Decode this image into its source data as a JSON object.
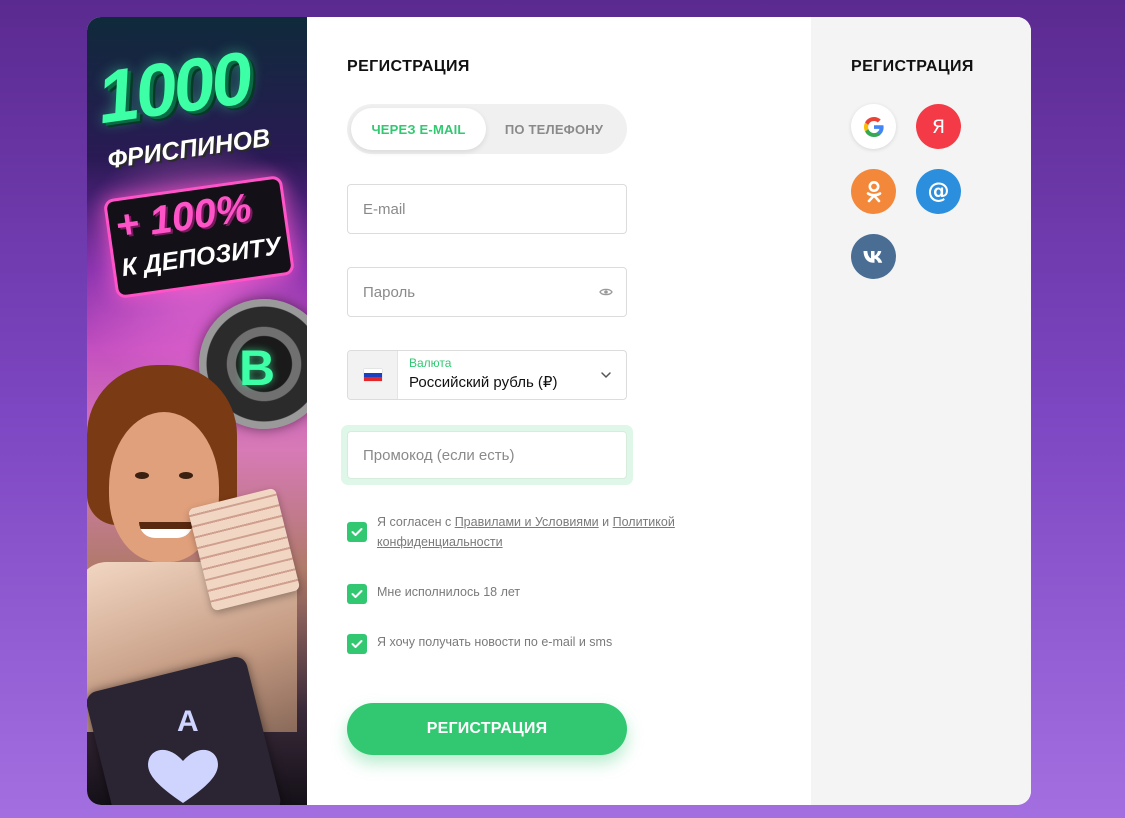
{
  "banner": {
    "headline_number": "1000",
    "headline_text": "ФРИСПИНОВ",
    "bonus_percent": "+ 100%",
    "bonus_text": "К ДЕПОЗИТУ",
    "card_letter": "A"
  },
  "form": {
    "title": "РЕГИСТРАЦИЯ",
    "tabs": [
      {
        "label": "ЧЕРЕЗ E-MAIL",
        "active": true
      },
      {
        "label": "ПО ТЕЛЕФОНУ",
        "active": false
      }
    ],
    "email": {
      "placeholder": "E-mail",
      "value": ""
    },
    "password": {
      "placeholder": "Пароль",
      "value": "",
      "icon": "eye-icon"
    },
    "currency": {
      "label": "Валюта",
      "value": "Российский рубль (₽)",
      "flag": "russia-flag-icon"
    },
    "promo": {
      "placeholder": "Промокод (если есть)",
      "value": ""
    },
    "checkboxes": {
      "terms": {
        "checked": true,
        "prefix": "Я согласен с",
        "rules_link": "Правилами и Условиями",
        "and": "и",
        "privacy_link": "Политикой конфиденциальности"
      },
      "age": {
        "checked": true,
        "text": "Мне исполнилось 18 лет"
      },
      "news": {
        "checked": true,
        "text": "Я хочу получать новости по e-mail и sms"
      }
    },
    "submit_label": "РЕГИСТРАЦИЯ"
  },
  "social": {
    "title": "РЕГИСТРАЦИЯ",
    "providers": [
      {
        "name": "google-icon",
        "glyph": "G",
        "color": "#ffffff"
      },
      {
        "name": "yandex-icon",
        "glyph": "Я",
        "color": "#f33a46"
      },
      {
        "name": "odnoklassniki-icon",
        "glyph": "ok",
        "color": "#f4883a"
      },
      {
        "name": "mail-ru-icon",
        "glyph": "@",
        "color": "#2b8fde"
      },
      {
        "name": "vk-icon",
        "glyph": "vk",
        "color": "#4a6e93"
      }
    ]
  },
  "colors": {
    "accent": "#32c872",
    "background_top": "#5b2a90",
    "background_bottom": "#a36fe0"
  }
}
